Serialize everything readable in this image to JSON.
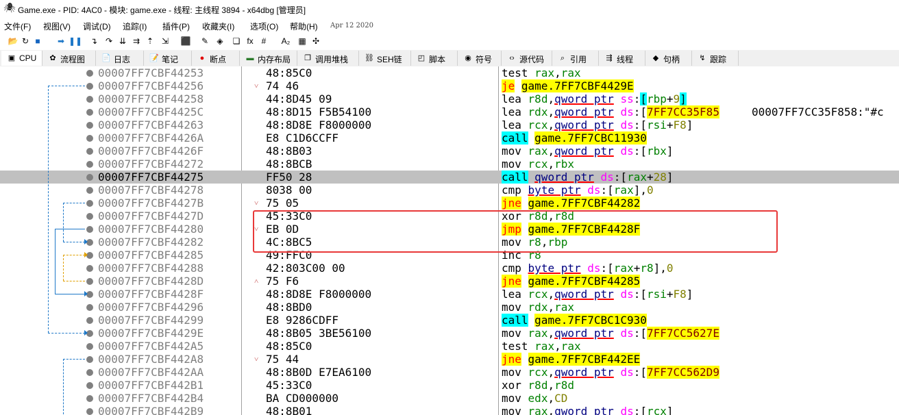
{
  "window": {
    "title": "Game.exe - PID: 4AC0 - 模块: game.exe - 线程: 主线程 3894 - x64dbg [管理员]",
    "icon": "bug-icon"
  },
  "menu": {
    "items": [
      "文件(F)",
      "视图(V)",
      "调试(D)",
      "追踪(I)",
      "插件(P)",
      "收藏夹(I)",
      "选项(O)",
      "帮助(H)"
    ],
    "date": "Apr 12 2020"
  },
  "toolbar": {
    "icons": [
      "open-folder-icon",
      "restart-icon",
      "stop-icon",
      "run-icon",
      "pause-icon",
      "step-into-icon",
      "step-over-icon",
      "trace-into-icon",
      "trace-over-icon",
      "execute-till-return-icon",
      "run-to-user-code-icon",
      "patch-icon",
      "comment-icon",
      "label-icon",
      "bookmark-icon",
      "function-icon",
      "hash-icon",
      "font-icon",
      "calculator-icon",
      "settings-icon"
    ],
    "glyphs": [
      "📂",
      "↻",
      "■",
      "➡",
      "❚❚",
      "↴",
      "↷",
      "⇊",
      "⇉",
      "⇡",
      "⇲",
      "⬛",
      "✎",
      "◈",
      "❏",
      "fx",
      "#",
      "A₂",
      "▦",
      "✣"
    ]
  },
  "tabs": [
    {
      "label": "CPU",
      "icon": "cpu-icon",
      "glyph": "▣",
      "active": true
    },
    {
      "label": "流程图",
      "icon": "graph-icon",
      "glyph": "✿"
    },
    {
      "label": "日志",
      "icon": "log-icon",
      "glyph": "📄"
    },
    {
      "label": "笔记",
      "icon": "notes-icon",
      "glyph": "📝"
    },
    {
      "label": "断点",
      "icon": "breakpoint-icon",
      "glyph": "●"
    },
    {
      "label": "内存布局",
      "icon": "memory-map-icon",
      "glyph": "▬"
    },
    {
      "label": "调用堆栈",
      "icon": "call-stack-icon",
      "glyph": "❐"
    },
    {
      "label": "SEH链",
      "icon": "seh-icon",
      "glyph": "⛓"
    },
    {
      "label": "脚本",
      "icon": "script-icon",
      "glyph": "◰"
    },
    {
      "label": "符号",
      "icon": "symbols-icon",
      "glyph": "◉"
    },
    {
      "label": "源代码",
      "icon": "source-icon",
      "glyph": "‹›"
    },
    {
      "label": "引用",
      "icon": "references-icon",
      "glyph": "⌕"
    },
    {
      "label": "线程",
      "icon": "threads-icon",
      "glyph": "⇶"
    },
    {
      "label": "句柄",
      "icon": "handles-icon",
      "glyph": "◆"
    },
    {
      "label": "跟踪",
      "icon": "trace-icon",
      "glyph": "↯"
    }
  ],
  "disasm": {
    "selected_address": "00007FF7CBF44275",
    "rows": [
      {
        "addr": "00007FF7CBF44253",
        "bytes": "48:85C0",
        "arrow": "",
        "instr": [
          [
            "test",
            "kw"
          ],
          [
            " ",
            "pun"
          ],
          [
            "rax",
            "reg"
          ],
          [
            ",",
            "pun"
          ],
          [
            "rax",
            "reg"
          ]
        ]
      },
      {
        "addr": "00007FF7CBF44256",
        "bytes": "74 46",
        "arrow": "˅",
        "instr": [
          [
            "je",
            "jcc"
          ],
          [
            " ",
            "pun"
          ],
          [
            "game.7FF7CBF4429E",
            "target"
          ]
        ]
      },
      {
        "addr": "00007FF7CBF44258",
        "bytes": "44:8D45 09",
        "arrow": "",
        "instr": [
          [
            "lea",
            "kw"
          ],
          [
            " ",
            "pun"
          ],
          [
            "r8d",
            "reg"
          ],
          [
            ",",
            "pun"
          ],
          [
            "qword ptr",
            "sz"
          ],
          [
            " ",
            "pun"
          ],
          [
            "ss",
            "seg"
          ],
          [
            ":",
            "pun"
          ],
          [
            "[",
            "brk"
          ],
          [
            "rbp",
            "reg"
          ],
          [
            "+",
            "pun"
          ],
          [
            "9",
            "num"
          ],
          [
            "]",
            "brk"
          ]
        ]
      },
      {
        "addr": "00007FF7CBF4425C",
        "bytes": "48:8D15 F5B54100",
        "arrow": "",
        "instr": [
          [
            "lea",
            "kw"
          ],
          [
            " ",
            "pun"
          ],
          [
            "rdx",
            "reg"
          ],
          [
            ",",
            "pun"
          ],
          [
            "qword ptr",
            "sz"
          ],
          [
            " ",
            "pun"
          ],
          [
            "ds",
            "seg"
          ],
          [
            ":",
            "pun"
          ],
          [
            "[",
            "pun"
          ],
          [
            "7FF7CC35F85",
            "addr"
          ]
        ],
        "comment": "00007FF7CC35F858:\"#c"
      },
      {
        "addr": "00007FF7CBF44263",
        "bytes": "48:8D8E F8000000",
        "arrow": "",
        "instr": [
          [
            "lea",
            "kw"
          ],
          [
            " ",
            "pun"
          ],
          [
            "rcx",
            "reg"
          ],
          [
            ",",
            "pun"
          ],
          [
            "qword ptr",
            "sz"
          ],
          [
            " ",
            "pun"
          ],
          [
            "ds",
            "seg"
          ],
          [
            ":",
            "pun"
          ],
          [
            "[",
            "pun"
          ],
          [
            "rsi",
            "reg"
          ],
          [
            "+",
            "pun"
          ],
          [
            "F8",
            "num"
          ],
          [
            "]",
            "pun"
          ]
        ]
      },
      {
        "addr": "00007FF7CBF4426A",
        "bytes": "E8 C1D6CCFF",
        "arrow": "",
        "instr": [
          [
            "call",
            "call"
          ],
          [
            " ",
            "pun"
          ],
          [
            "game.7FF7CBC11930",
            "target"
          ]
        ]
      },
      {
        "addr": "00007FF7CBF4426F",
        "bytes": "48:8B03",
        "arrow": "",
        "instr": [
          [
            "mov",
            "kw"
          ],
          [
            " ",
            "pun"
          ],
          [
            "rax",
            "reg"
          ],
          [
            ",",
            "pun"
          ],
          [
            "qword ptr",
            "sz"
          ],
          [
            " ",
            "pun"
          ],
          [
            "ds",
            "seg"
          ],
          [
            ":",
            "pun"
          ],
          [
            "[",
            "pun"
          ],
          [
            "rbx",
            "reg"
          ],
          [
            "]",
            "pun"
          ]
        ]
      },
      {
        "addr": "00007FF7CBF44272",
        "bytes": "48:8BCB",
        "arrow": "",
        "instr": [
          [
            "mov",
            "kw"
          ],
          [
            " ",
            "pun"
          ],
          [
            "rcx",
            "reg"
          ],
          [
            ",",
            "pun"
          ],
          [
            "rbx",
            "reg"
          ]
        ]
      },
      {
        "addr": "00007FF7CBF44275",
        "bytes": "FF50 28",
        "arrow": "",
        "selected": true,
        "instr": [
          [
            "call",
            "call"
          ],
          [
            " ",
            "pun"
          ],
          [
            "qword ptr",
            "sz"
          ],
          [
            " ",
            "pun"
          ],
          [
            "ds",
            "seg"
          ],
          [
            ":",
            "pun"
          ],
          [
            "[",
            "pun"
          ],
          [
            "rax",
            "reg"
          ],
          [
            "+",
            "pun"
          ],
          [
            "28",
            "num"
          ],
          [
            "]",
            "pun"
          ]
        ]
      },
      {
        "addr": "00007FF7CBF44278",
        "bytes": "8038 00",
        "arrow": "",
        "instr": [
          [
            "cmp",
            "kw"
          ],
          [
            " ",
            "pun"
          ],
          [
            "byte ptr",
            "sz"
          ],
          [
            " ",
            "pun"
          ],
          [
            "ds",
            "seg"
          ],
          [
            ":",
            "pun"
          ],
          [
            "[",
            "pun"
          ],
          [
            "rax",
            "reg"
          ],
          [
            "]",
            "pun"
          ],
          [
            ",",
            "pun"
          ],
          [
            "0",
            "num"
          ]
        ]
      },
      {
        "addr": "00007FF7CBF4427B",
        "bytes": "75 05",
        "arrow": "˅",
        "instr": [
          [
            "jne",
            "jcc"
          ],
          [
            " ",
            "pun"
          ],
          [
            "game.7FF7CBF44282",
            "target"
          ]
        ]
      },
      {
        "addr": "00007FF7CBF4427D",
        "bytes": "45:33C0",
        "arrow": "",
        "instr": [
          [
            "xor",
            "kw"
          ],
          [
            " ",
            "pun"
          ],
          [
            "r8d",
            "reg"
          ],
          [
            ",",
            "pun"
          ],
          [
            "r8d",
            "reg"
          ]
        ]
      },
      {
        "addr": "00007FF7CBF44280",
        "bytes": "EB 0D",
        "arrow": "˅",
        "instr": [
          [
            "jmp",
            "jcc"
          ],
          [
            " ",
            "pun"
          ],
          [
            "game.7FF7CBF4428F",
            "target"
          ]
        ]
      },
      {
        "addr": "00007FF7CBF44282",
        "bytes": "4C:8BC5",
        "arrow": "",
        "instr": [
          [
            "mov",
            "kw"
          ],
          [
            " ",
            "pun"
          ],
          [
            "r8",
            "reg"
          ],
          [
            ",",
            "pun"
          ],
          [
            "rbp",
            "reg"
          ]
        ]
      },
      {
        "addr": "00007FF7CBF44285",
        "bytes": "49:FFC0",
        "arrow": "",
        "instr": [
          [
            "inc",
            "kw"
          ],
          [
            " ",
            "pun"
          ],
          [
            "r8",
            "reg"
          ]
        ]
      },
      {
        "addr": "00007FF7CBF44288",
        "bytes": "42:803C00 00",
        "arrow": "",
        "instr": [
          [
            "cmp",
            "kw"
          ],
          [
            " ",
            "pun"
          ],
          [
            "byte ptr",
            "sz"
          ],
          [
            " ",
            "pun"
          ],
          [
            "ds",
            "seg"
          ],
          [
            ":",
            "pun"
          ],
          [
            "[",
            "pun"
          ],
          [
            "rax",
            "reg"
          ],
          [
            "+",
            "pun"
          ],
          [
            "r8",
            "reg"
          ],
          [
            "]",
            "pun"
          ],
          [
            ",",
            "pun"
          ],
          [
            "0",
            "num"
          ]
        ]
      },
      {
        "addr": "00007FF7CBF4428D",
        "bytes": "75 F6",
        "arrow": "˄",
        "instr": [
          [
            "jne",
            "jcc"
          ],
          [
            " ",
            "pun"
          ],
          [
            "game.7FF7CBF44285",
            "target"
          ]
        ]
      },
      {
        "addr": "00007FF7CBF4428F",
        "bytes": "48:8D8E F8000000",
        "arrow": "",
        "instr": [
          [
            "lea",
            "kw"
          ],
          [
            " ",
            "pun"
          ],
          [
            "rcx",
            "reg"
          ],
          [
            ",",
            "pun"
          ],
          [
            "qword ptr",
            "sz"
          ],
          [
            " ",
            "pun"
          ],
          [
            "ds",
            "seg"
          ],
          [
            ":",
            "pun"
          ],
          [
            "[",
            "pun"
          ],
          [
            "rsi",
            "reg"
          ],
          [
            "+",
            "pun"
          ],
          [
            "F8",
            "num"
          ],
          [
            "]",
            "pun"
          ]
        ]
      },
      {
        "addr": "00007FF7CBF44296",
        "bytes": "48:8BD0",
        "arrow": "",
        "instr": [
          [
            "mov",
            "kw"
          ],
          [
            " ",
            "pun"
          ],
          [
            "rdx",
            "reg"
          ],
          [
            ",",
            "pun"
          ],
          [
            "rax",
            "reg"
          ]
        ]
      },
      {
        "addr": "00007FF7CBF44299",
        "bytes": "E8 9286CDFF",
        "arrow": "",
        "instr": [
          [
            "call",
            "call"
          ],
          [
            " ",
            "pun"
          ],
          [
            "game.7FF7CBC1C930",
            "target"
          ]
        ]
      },
      {
        "addr": "00007FF7CBF4429E",
        "bytes": "48:8B05 3BE56100",
        "arrow": "",
        "instr": [
          [
            "mov",
            "kw"
          ],
          [
            " ",
            "pun"
          ],
          [
            "rax",
            "reg"
          ],
          [
            ",",
            "pun"
          ],
          [
            "qword ptr",
            "sz"
          ],
          [
            " ",
            "pun"
          ],
          [
            "ds",
            "seg"
          ],
          [
            ":",
            "pun"
          ],
          [
            "[",
            "pun"
          ],
          [
            "7FF7CC5627E",
            "addr"
          ]
        ]
      },
      {
        "addr": "00007FF7CBF442A5",
        "bytes": "48:85C0",
        "arrow": "",
        "instr": [
          [
            "test",
            "kw"
          ],
          [
            " ",
            "pun"
          ],
          [
            "rax",
            "reg"
          ],
          [
            ",",
            "pun"
          ],
          [
            "rax",
            "reg"
          ]
        ]
      },
      {
        "addr": "00007FF7CBF442A8",
        "bytes": "75 44",
        "arrow": "˅",
        "instr": [
          [
            "jne",
            "jcc"
          ],
          [
            " ",
            "pun"
          ],
          [
            "game.7FF7CBF442EE",
            "target"
          ]
        ]
      },
      {
        "addr": "00007FF7CBF442AA",
        "bytes": "48:8B0D E7EA6100",
        "arrow": "",
        "instr": [
          [
            "mov",
            "kw"
          ],
          [
            " ",
            "pun"
          ],
          [
            "rcx",
            "reg"
          ],
          [
            ",",
            "pun"
          ],
          [
            "qword ptr",
            "sz"
          ],
          [
            " ",
            "pun"
          ],
          [
            "ds",
            "seg"
          ],
          [
            ":",
            "pun"
          ],
          [
            "[",
            "pun"
          ],
          [
            "7FF7CC562D9",
            "addr"
          ]
        ]
      },
      {
        "addr": "00007FF7CBF442B1",
        "bytes": "45:33C0",
        "arrow": "",
        "instr": [
          [
            "xor",
            "kw"
          ],
          [
            " ",
            "pun"
          ],
          [
            "r8d",
            "reg"
          ],
          [
            ",",
            "pun"
          ],
          [
            "r8d",
            "reg"
          ]
        ]
      },
      {
        "addr": "00007FF7CBF442B4",
        "bytes": "BA CD000000",
        "arrow": "",
        "instr": [
          [
            "mov",
            "kw"
          ],
          [
            " ",
            "pun"
          ],
          [
            "edx",
            "reg"
          ],
          [
            ",",
            "pun"
          ],
          [
            "CD",
            "num"
          ]
        ]
      },
      {
        "addr": "00007FF7CBF442B9",
        "bytes": "48:8B01",
        "arrow": "",
        "instr": [
          [
            "mov",
            "kw"
          ],
          [
            " ",
            "pun"
          ],
          [
            "rax",
            "reg"
          ],
          [
            ",",
            "pun"
          ],
          [
            "qword ptr",
            "sz"
          ],
          [
            " ",
            "pun"
          ],
          [
            "ds",
            "seg"
          ],
          [
            ":",
            "pun"
          ],
          [
            "[",
            "pun"
          ],
          [
            "rcx",
            "reg"
          ],
          [
            "]",
            "pun"
          ]
        ]
      }
    ]
  },
  "colors": {
    "jump_highlight": "#ffff00",
    "call_highlight": "#00ffff",
    "segment": "#ff00ff",
    "register": "#008000",
    "number": "#808000",
    "address_gray": "#808080",
    "annotation_box": "#e83838"
  }
}
